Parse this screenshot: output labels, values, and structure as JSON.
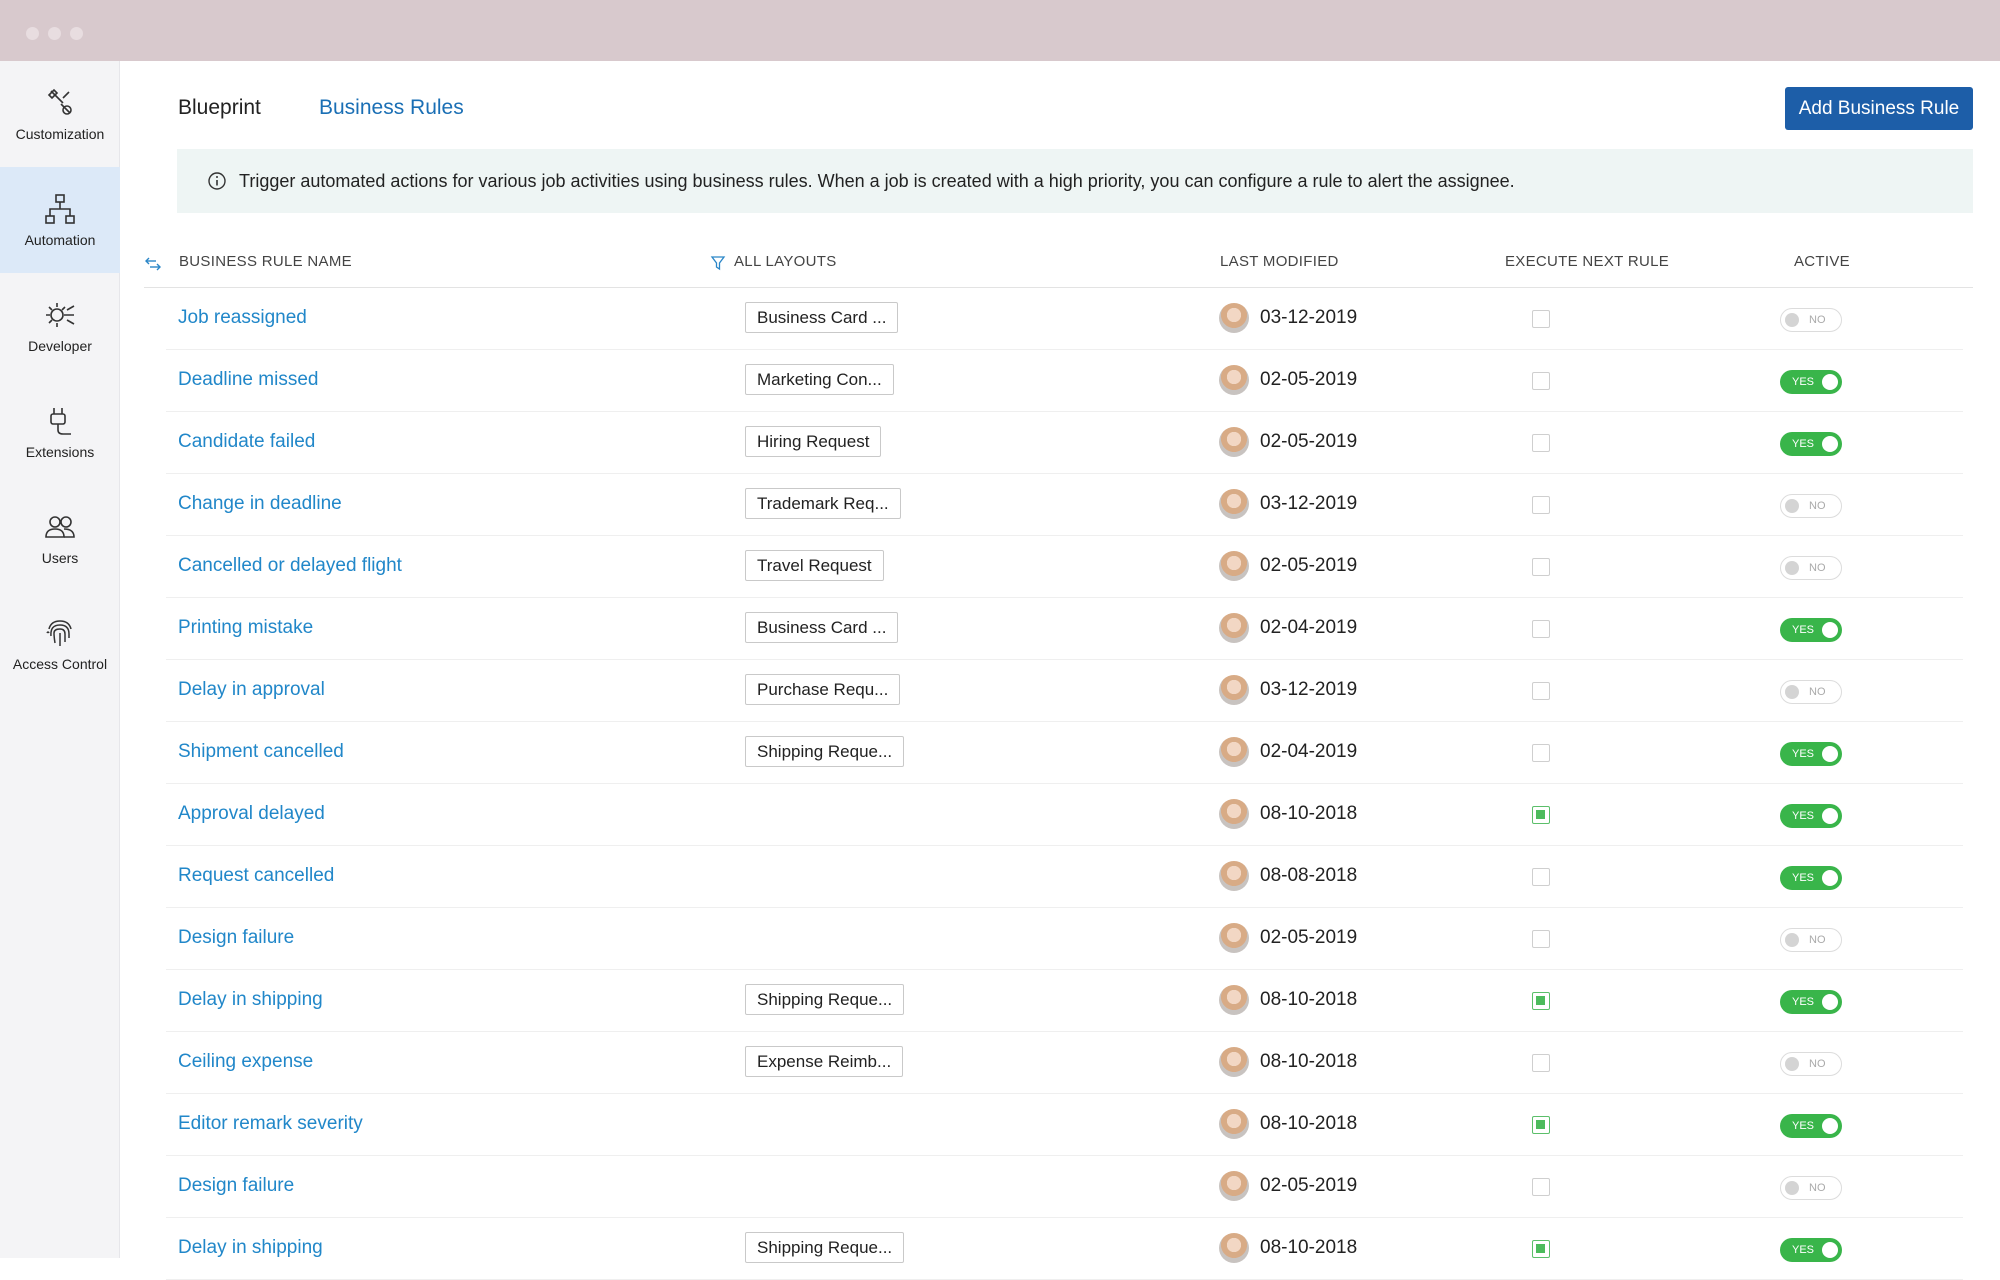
{
  "sidebar": {
    "items": [
      {
        "label": "Customization",
        "icon": "customization-icon"
      },
      {
        "label": "Automation",
        "icon": "automation-icon",
        "active": true
      },
      {
        "label": "Developer",
        "icon": "developer-icon"
      },
      {
        "label": "Extensions",
        "icon": "extensions-icon"
      },
      {
        "label": "Users",
        "icon": "users-icon"
      },
      {
        "label": "Access Control",
        "icon": "fingerprint-icon"
      }
    ]
  },
  "header": {
    "tabs": [
      "Blueprint",
      "Business Rules"
    ],
    "add_button": "Add Business Rule"
  },
  "info": {
    "text": "Trigger automated actions for various job activities using business rules. When a job is created with a high priority, you can configure a rule to alert the assignee."
  },
  "table": {
    "columns": [
      "BUSINESS RULE NAME",
      "ALL LAYOUTS",
      "LAST MODIFIED",
      "EXECUTE NEXT RULE",
      "ACTIVE"
    ],
    "rows": [
      {
        "name": "Job reassigned",
        "layout": "Business Card ...",
        "date": "03-12-2019",
        "execute_next": false,
        "active": "NO"
      },
      {
        "name": "Deadline missed",
        "layout": "Marketing Con...",
        "date": "02-05-2019",
        "execute_next": false,
        "active": "YES"
      },
      {
        "name": "Candidate failed",
        "layout": "Hiring Request",
        "date": "02-05-2019",
        "execute_next": false,
        "active": "YES"
      },
      {
        "name": "Change in deadline",
        "layout": "Trademark Req...",
        "date": "03-12-2019",
        "execute_next": false,
        "active": "NO"
      },
      {
        "name": "Cancelled or delayed flight",
        "layout": "Travel Request",
        "date": "02-05-2019",
        "execute_next": false,
        "active": "NO"
      },
      {
        "name": "Printing mistake",
        "layout": "Business Card ...",
        "date": "02-04-2019",
        "execute_next": false,
        "active": "YES"
      },
      {
        "name": "Delay in approval",
        "layout": "Purchase Requ...",
        "date": "03-12-2019",
        "execute_next": false,
        "active": "NO"
      },
      {
        "name": "Shipment cancelled",
        "layout": "Shipping Reque...",
        "date": "02-04-2019",
        "execute_next": false,
        "active": "YES"
      },
      {
        "name": "Approval delayed",
        "layout": "",
        "date": "08-10-2018",
        "execute_next": true,
        "active": "YES"
      },
      {
        "name": "Request cancelled",
        "layout": "",
        "date": "08-08-2018",
        "execute_next": false,
        "active": "YES"
      },
      {
        "name": "Design failure",
        "layout": "",
        "date": "02-05-2019",
        "execute_next": false,
        "active": "NO"
      },
      {
        "name": "Delay in shipping",
        "layout": "Shipping Reque...",
        "date": "08-10-2018",
        "execute_next": true,
        "active": "YES"
      },
      {
        "name": "Ceiling expense",
        "layout": "Expense Reimb...",
        "date": "08-10-2018",
        "execute_next": false,
        "active": "NO"
      },
      {
        "name": "Editor remark severity",
        "layout": "",
        "date": "08-10-2018",
        "execute_next": true,
        "active": "YES"
      },
      {
        "name": "Design failure",
        "layout": "",
        "date": "02-05-2019",
        "execute_next": false,
        "active": "NO"
      },
      {
        "name": "Delay in shipping",
        "layout": "Shipping Reque...",
        "date": "08-10-2018",
        "execute_next": true,
        "active": "YES"
      }
    ]
  }
}
